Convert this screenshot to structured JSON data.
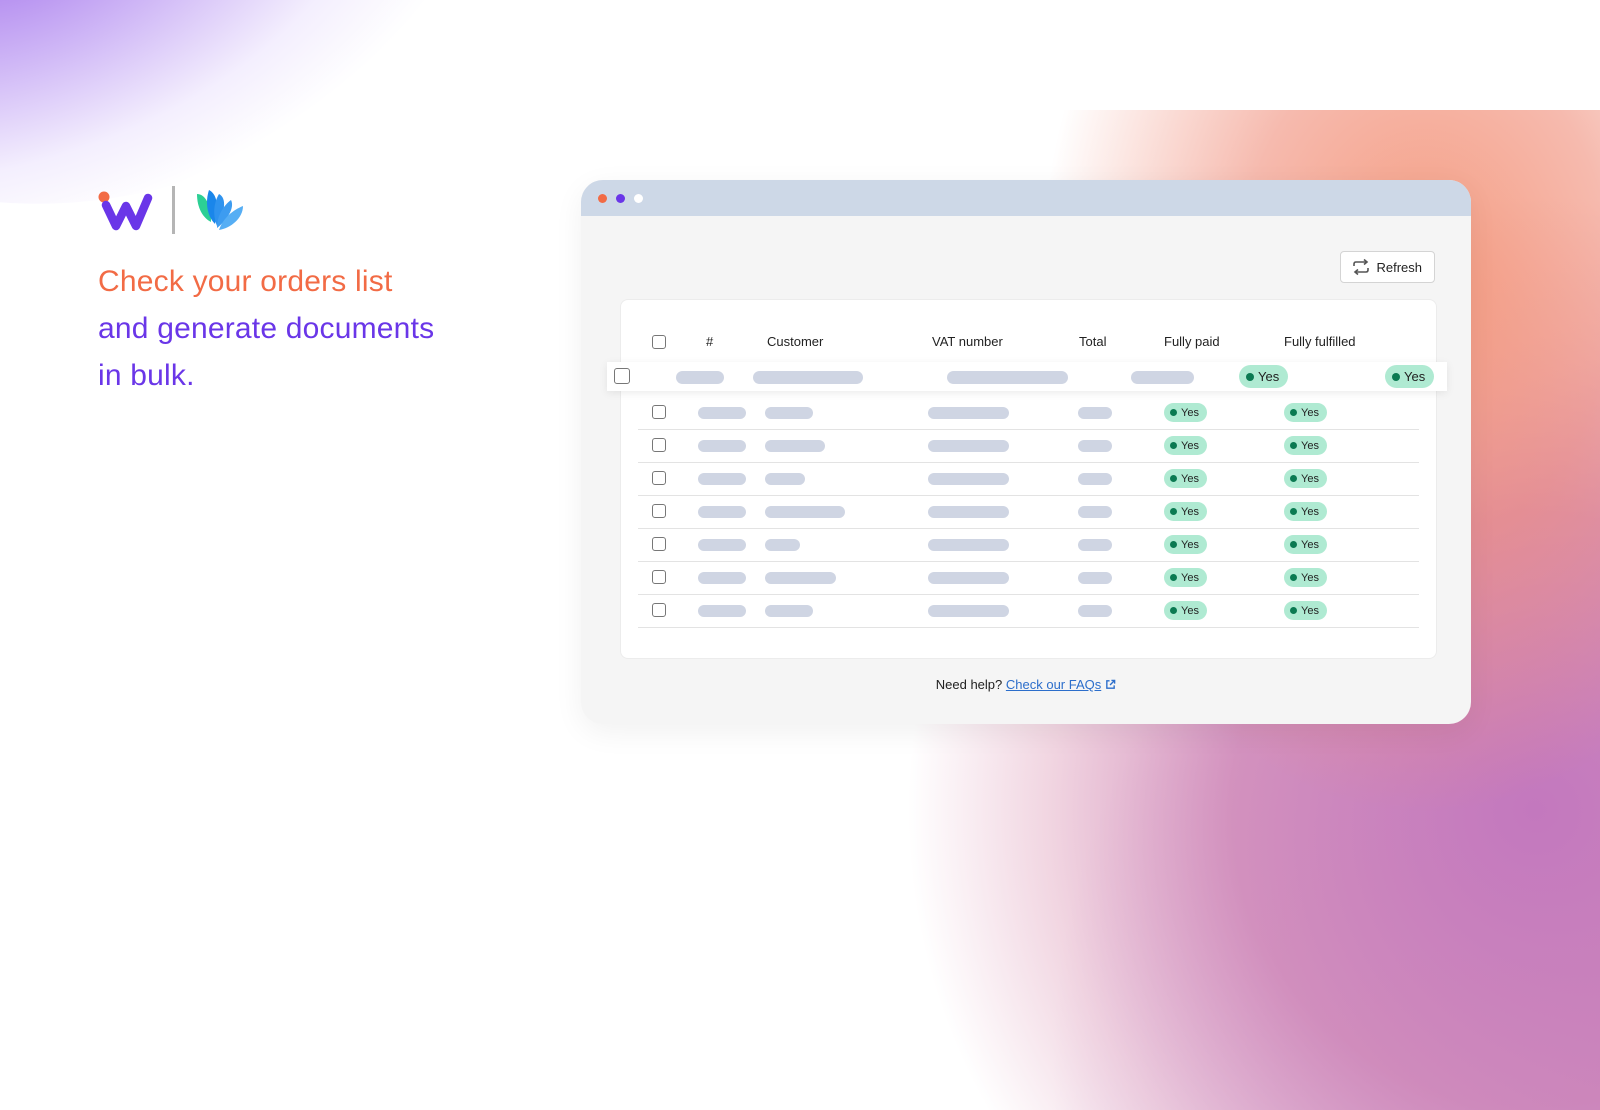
{
  "headline": {
    "line1": "Check your orders list",
    "line2": "and generate documents",
    "line3": "in bulk."
  },
  "brand": {
    "logo_primary": "w-logo-icon",
    "logo_secondary": "leaf-logo-icon"
  },
  "colors": {
    "accent_orange": "#f26b45",
    "accent_purple": "#6a36e8",
    "titlebar": "#cdd8e7",
    "badge_bg": "#afead2",
    "badge_dot": "#0b7a52",
    "link": "#2c6ecb"
  },
  "browser": {
    "window_dots": [
      "#f26b45",
      "#6a36e8",
      "#ffffff"
    ],
    "refresh_label": "Refresh",
    "refresh_icon": "refresh-icon"
  },
  "table": {
    "columns": [
      "#",
      "Customer",
      "VAT number",
      "Total",
      "Fully paid",
      "Fully fulfilled"
    ],
    "highlighted_row": {
      "fully_paid": "Yes",
      "fully_fulfilled": "Yes"
    },
    "rows": [
      {
        "fully_paid": "Yes",
        "fully_fulfilled": "Yes"
      },
      {
        "fully_paid": "Yes",
        "fully_fulfilled": "Yes"
      },
      {
        "fully_paid": "Yes",
        "fully_fulfilled": "Yes"
      },
      {
        "fully_paid": "Yes",
        "fully_fulfilled": "Yes"
      },
      {
        "fully_paid": "Yes",
        "fully_fulfilled": "Yes"
      },
      {
        "fully_paid": "Yes",
        "fully_fulfilled": "Yes"
      },
      {
        "fully_paid": "Yes",
        "fully_fulfilled": "Yes"
      }
    ]
  },
  "help": {
    "prefix": "Need help?",
    "link_label": "Check our FAQs",
    "link_icon": "external-link-icon"
  }
}
